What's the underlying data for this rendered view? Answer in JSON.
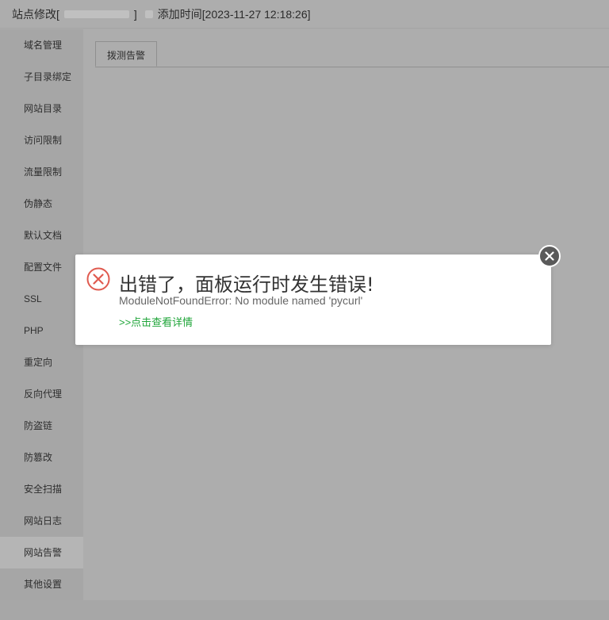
{
  "titlebar": {
    "prefix": "站点修改[",
    "bracket_close": "]",
    "suffix": "添加时间[2023-11-27 12:18:26]"
  },
  "sidebar": {
    "items": [
      {
        "label": "域名管理",
        "active": false
      },
      {
        "label": "子目录绑定",
        "active": false
      },
      {
        "label": "网站目录",
        "active": false
      },
      {
        "label": "访问限制",
        "active": false
      },
      {
        "label": "流量限制",
        "active": false
      },
      {
        "label": "伪静态",
        "active": false
      },
      {
        "label": "默认文档",
        "active": false
      },
      {
        "label": "配置文件",
        "active": false
      },
      {
        "label": "SSL",
        "active": false
      },
      {
        "label": "PHP",
        "active": false
      },
      {
        "label": "重定向",
        "active": false
      },
      {
        "label": "反向代理",
        "active": false
      },
      {
        "label": "防盗链",
        "active": false
      },
      {
        "label": "防篡改",
        "active": false
      },
      {
        "label": "安全扫描",
        "active": false
      },
      {
        "label": "网站日志",
        "active": false
      },
      {
        "label": "网站告警",
        "active": true
      },
      {
        "label": "其他设置",
        "active": false
      }
    ]
  },
  "tabs": [
    {
      "label": "拨测告警",
      "active": true
    }
  ],
  "dialog": {
    "title": "出错了，面板运行时发生错误!",
    "message": "ModuleNotFoundError: No module named 'pycurl'",
    "link": ">>点击查看详情",
    "icon": "error-x-circle-icon",
    "close_icon": "close-icon"
  },
  "colors": {
    "overlay_bg": "#ababab",
    "error_red": "#e05a4f",
    "link_green": "#20a53a",
    "close_bg": "#5a5a5a"
  }
}
